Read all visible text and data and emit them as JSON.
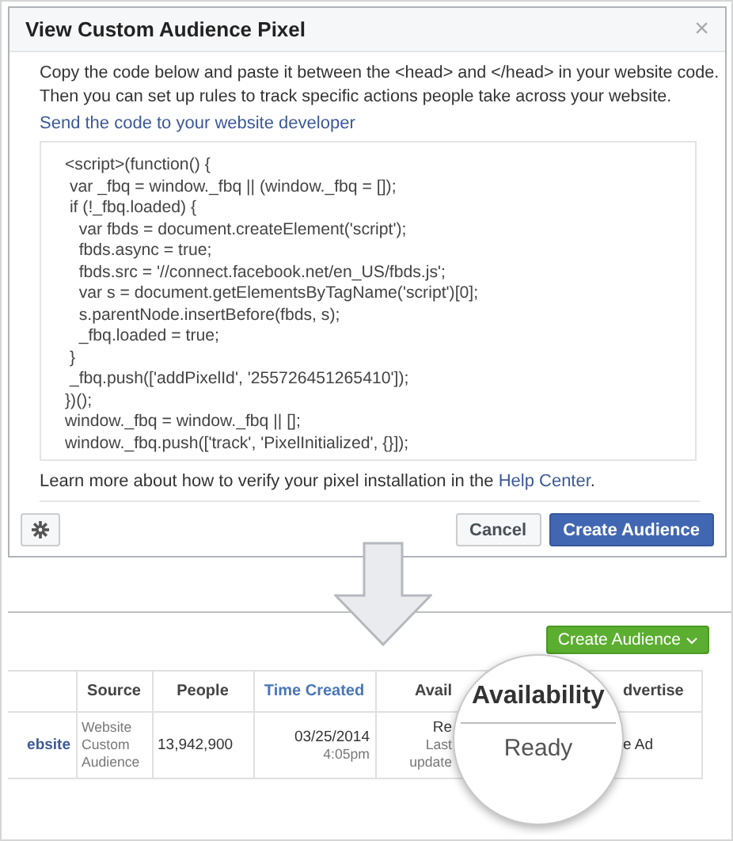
{
  "dialog": {
    "title": "View Custom Audience Pixel",
    "close": "×",
    "intro": [
      "Copy the code below and paste it between the <head> and </head> in your website code.",
      "Then you can set  up rules to track specific actions people take across your website."
    ],
    "send_link": "Send the code to your website developer",
    "code": [
      "<script>(function() {",
      " var _fbq = window._fbq || (window._fbq = []);",
      " if (!_fbq.loaded) {",
      "   var fbds = document.createElement('script');",
      "   fbds.async = true;",
      "   fbds.src = '//connect.facebook.net/en_US/fbds.js';",
      "   var s = document.getElementsByTagName('script')[0];",
      "   s.parentNode.insertBefore(fbds, s);",
      "   _fbq.loaded = true;",
      " }",
      " _fbq.push(['addPixelId', '255726451265410']);",
      "})();",
      "window._fbq = window._fbq || [];",
      "window._fbq.push(['track', 'PixelInitialized', {}]);"
    ],
    "help": {
      "text": "Learn more about how to verify your pixel installation in the",
      "link": "Help Center",
      "end": "."
    },
    "buttons": [
      {
        "label": "Cancel",
        "kind": "secondary"
      },
      {
        "label": "Create Audience",
        "kind": "primary"
      }
    ]
  },
  "audiences": {
    "create_button": "Create Audience",
    "columns": [
      {
        "label": "Source",
        "sorted": false
      },
      {
        "label": "People",
        "sorted": false
      },
      {
        "label": "Time Created",
        "sorted": true
      },
      {
        "label": "Avail",
        "sorted": false
      },
      {
        "label": "dvertise",
        "sorted": false
      }
    ],
    "rows": [
      {
        "name": "ebsite",
        "source": "Website Custom Audience",
        "people": "13,942,900",
        "date": "03/25/2014",
        "time": "4:05pm",
        "status": "Re",
        "updated": "Last update",
        "action": "e Ad"
      }
    ],
    "magnifier": {
      "header": "Availability",
      "value": "Ready"
    }
  }
}
